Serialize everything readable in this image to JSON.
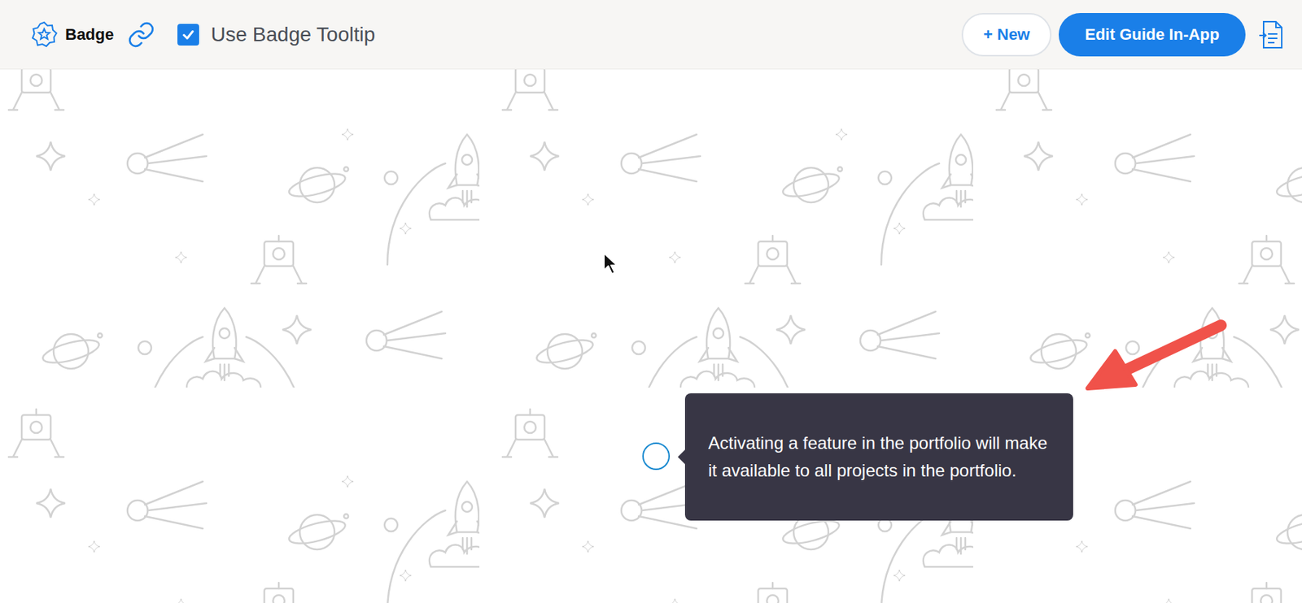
{
  "toolbar": {
    "guide_type": "Badge",
    "checkbox": {
      "label": "Use Badge Tooltip",
      "checked": true
    },
    "buttons": [
      "+ New",
      "Edit Guide In-App"
    ]
  },
  "tooltip": {
    "text": "Activating a feature in the portfolio will make it available to all projects in the portfolio."
  }
}
